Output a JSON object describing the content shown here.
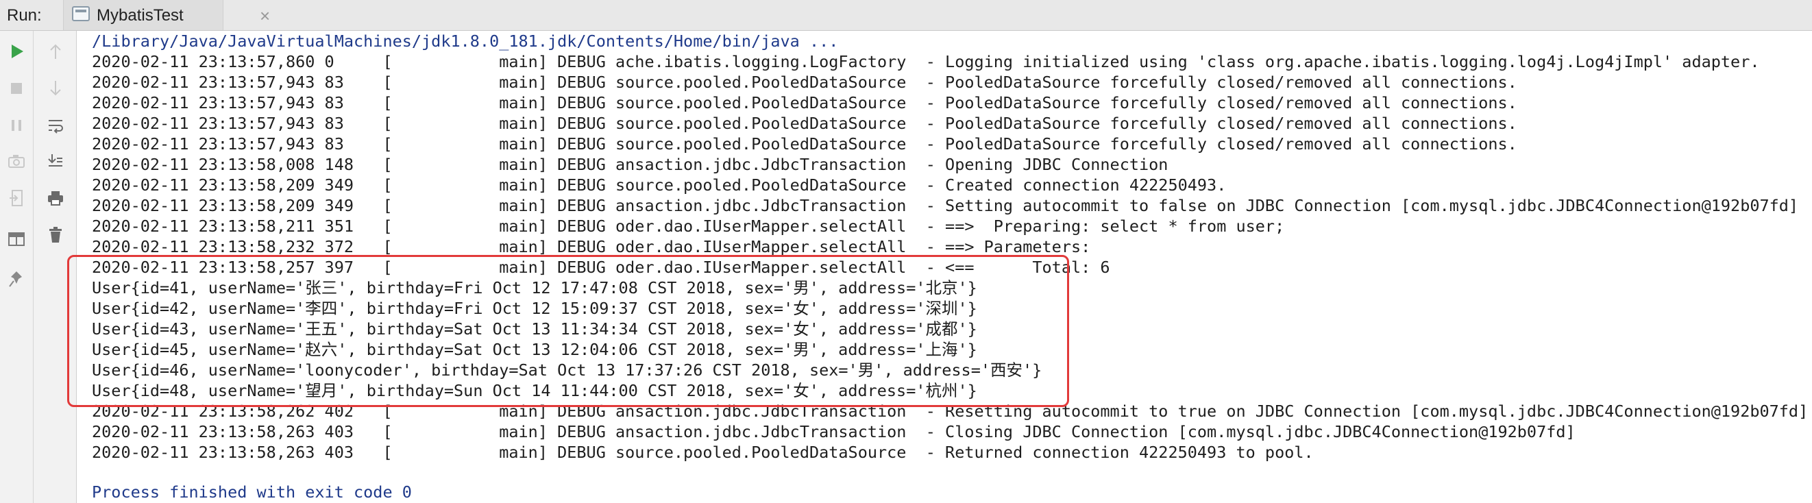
{
  "run_bar": {
    "label": "Run:",
    "tab_title": "MybatisTest",
    "tab_close": "×"
  },
  "toolbar": {
    "icons": [
      "run-icon",
      "stop-icon",
      "pause-icon",
      "camera-icon",
      "exit-icon",
      "layout-icon",
      "pin-icon"
    ],
    "icons2": [
      "up-arrow-icon",
      "down-arrow-icon",
      "soft-wrap-icon",
      "scroll-to-end-icon",
      "print-icon",
      "trash-icon"
    ]
  },
  "console": {
    "command": "/Library/Java/JavaVirtualMachines/jdk1.8.0_181.jdk/Contents/Home/bin/java ...",
    "lines": [
      "2020-02-11 23:13:57,860 0     [           main] DEBUG ache.ibatis.logging.LogFactory  - Logging initialized using 'class org.apache.ibatis.logging.log4j.Log4jImpl' adapter.",
      "2020-02-11 23:13:57,943 83    [           main] DEBUG source.pooled.PooledDataSource  - PooledDataSource forcefully closed/removed all connections.",
      "2020-02-11 23:13:57,943 83    [           main] DEBUG source.pooled.PooledDataSource  - PooledDataSource forcefully closed/removed all connections.",
      "2020-02-11 23:13:57,943 83    [           main] DEBUG source.pooled.PooledDataSource  - PooledDataSource forcefully closed/removed all connections.",
      "2020-02-11 23:13:57,943 83    [           main] DEBUG source.pooled.PooledDataSource  - PooledDataSource forcefully closed/removed all connections.",
      "2020-02-11 23:13:58,008 148   [           main] DEBUG ansaction.jdbc.JdbcTransaction  - Opening JDBC Connection",
      "2020-02-11 23:13:58,209 349   [           main] DEBUG source.pooled.PooledDataSource  - Created connection 422250493.",
      "2020-02-11 23:13:58,209 349   [           main] DEBUG ansaction.jdbc.JdbcTransaction  - Setting autocommit to false on JDBC Connection [com.mysql.jdbc.JDBC4Connection@192b07fd]",
      "2020-02-11 23:13:58,211 351   [           main] DEBUG oder.dao.IUserMapper.selectAll  - ==>  Preparing: select * from user;",
      "2020-02-11 23:13:58,232 372   [           main] DEBUG oder.dao.IUserMapper.selectAll  - ==> Parameters: ",
      "2020-02-11 23:13:58,257 397   [           main] DEBUG oder.dao.IUserMapper.selectAll  - <==      Total: 6",
      "User{id=41, userName='张三', birthday=Fri Oct 12 17:47:08 CST 2018, sex='男', address='北京'}",
      "User{id=42, userName='李四', birthday=Fri Oct 12 15:09:37 CST 2018, sex='女', address='深圳'}",
      "User{id=43, userName='王五', birthday=Sat Oct 13 11:34:34 CST 2018, sex='女', address='成都'}",
      "User{id=45, userName='赵六', birthday=Sat Oct 13 12:04:06 CST 2018, sex='男', address='上海'}",
      "User{id=46, userName='loonycoder', birthday=Sat Oct 13 17:37:26 CST 2018, sex='男', address='西安'}",
      "User{id=48, userName='望月', birthday=Sun Oct 14 11:44:00 CST 2018, sex='女', address='杭州'}",
      "2020-02-11 23:13:58,262 402   [           main] DEBUG ansaction.jdbc.JdbcTransaction  - Resetting autocommit to true on JDBC Connection [com.mysql.jdbc.JDBC4Connection@192b07fd]",
      "2020-02-11 23:13:58,263 403   [           main] DEBUG ansaction.jdbc.JdbcTransaction  - Closing JDBC Connection [com.mysql.jdbc.JDBC4Connection@192b07fd]",
      "2020-02-11 23:13:58,263 403   [           main] DEBUG source.pooled.PooledDataSource  - Returned connection 422250493 to pool."
    ],
    "exit_message": "Process finished with exit code 0"
  }
}
